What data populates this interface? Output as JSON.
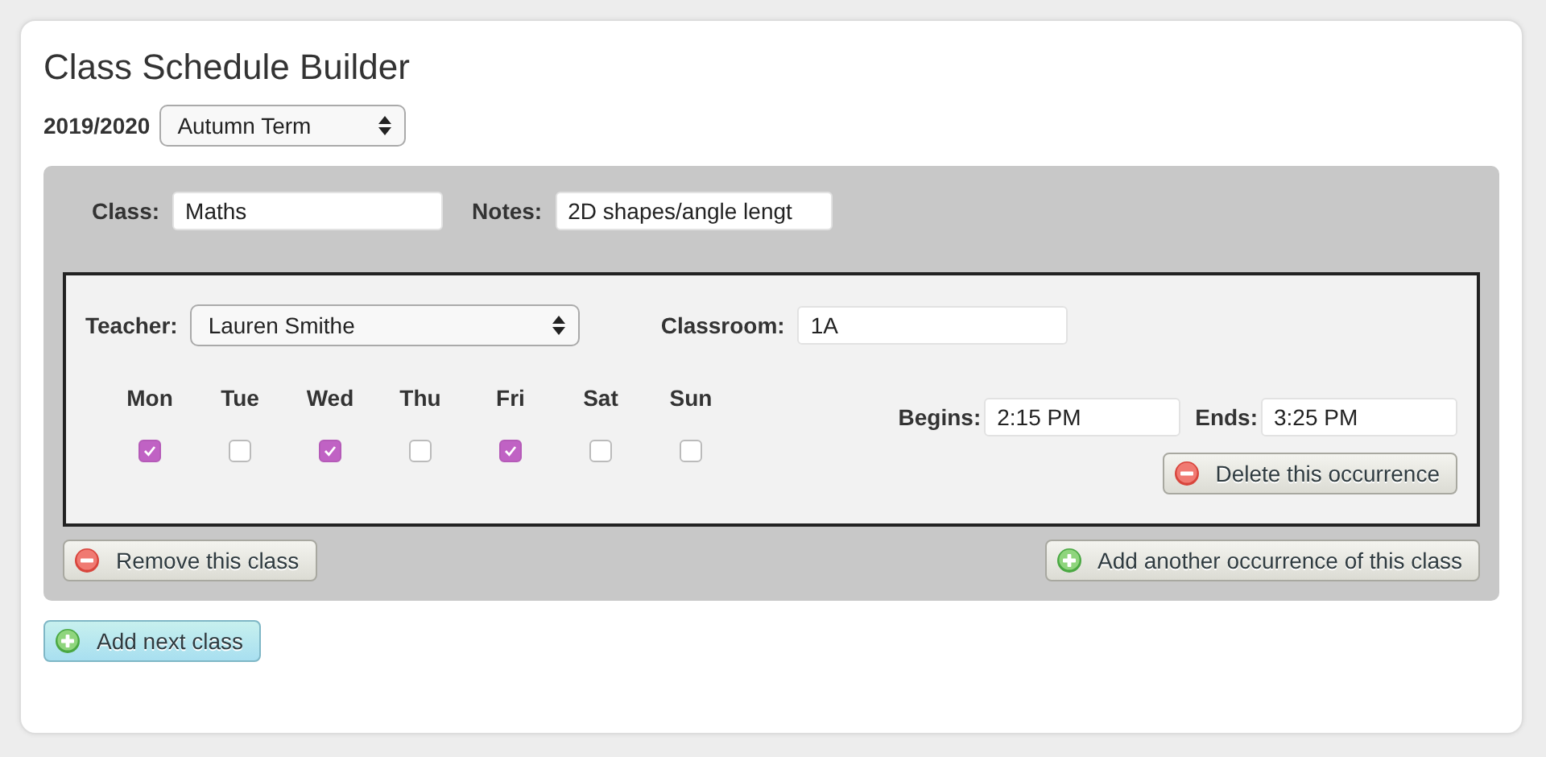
{
  "title": "Class Schedule Builder",
  "year": "2019/2020",
  "term": {
    "value": "Autumn Term"
  },
  "class_panel": {
    "class_label": "Class:",
    "class_value": "Maths",
    "notes_label": "Notes:",
    "notes_value": "2D shapes/angle lengt",
    "occurrence": {
      "teacher_label": "Teacher:",
      "teacher_value": "Lauren Smithe",
      "classroom_label": "Classroom:",
      "classroom_value": "1A",
      "days": [
        {
          "label": "Mon",
          "checked": true
        },
        {
          "label": "Tue",
          "checked": false
        },
        {
          "label": "Wed",
          "checked": true
        },
        {
          "label": "Thu",
          "checked": false
        },
        {
          "label": "Fri",
          "checked": true
        },
        {
          "label": "Sat",
          "checked": false
        },
        {
          "label": "Sun",
          "checked": false
        }
      ],
      "begins_label": "Begins:",
      "begins_value": "2:15 PM",
      "ends_label": "Ends:",
      "ends_value": "3:25 PM",
      "delete_button": {
        "label": "Delete this occurrence",
        "kind": "remove"
      }
    },
    "remove_button": {
      "label": "Remove this class",
      "kind": "remove"
    },
    "add_occurrence_button": {
      "label": "Add another occurrence of this class",
      "kind": "add"
    }
  },
  "add_class_button": {
    "label": "Add next class",
    "kind": "add"
  }
}
